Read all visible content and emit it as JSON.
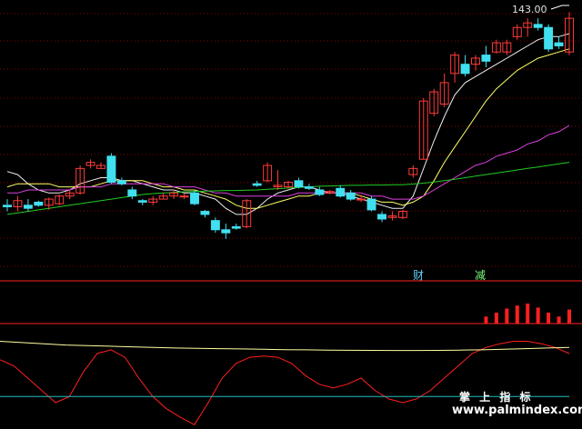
{
  "header": {
    "last_price": "143.00"
  },
  "signals": {
    "left": "财",
    "right": "减"
  },
  "watermark": {
    "name": "掌 上 指 标",
    "url": "www.palmindex.com"
  },
  "colors": {
    "background": "#000000",
    "grid": "#8b0000",
    "up_candle": "#ff3b3b",
    "down_candle": "#40e0f0",
    "ma_white": "#f0f0f0",
    "ma_yellow": "#ffff66",
    "ma_magenta": "#e040e0",
    "ma_green": "#22cc22",
    "osc_red": "#ff2020",
    "osc_yellow": "#ffffa0",
    "osc_cyan": "#20c0c0",
    "separator": "#ff2020"
  },
  "chart_data": [
    {
      "type": "candlestick",
      "title": "",
      "ylim": [
        60,
        146
      ],
      "candles": [
        [
          82,
          84,
          80,
          81.5
        ],
        [
          81.5,
          85,
          80,
          83.5
        ],
        [
          82,
          84,
          80,
          81
        ],
        [
          83,
          83.5,
          81.5,
          82
        ],
        [
          82,
          84.5,
          80.5,
          84
        ],
        [
          82.5,
          85.5,
          82,
          85
        ],
        [
          85,
          87,
          84,
          86
        ],
        [
          86,
          95,
          85.5,
          94
        ],
        [
          95,
          97,
          94,
          96
        ],
        [
          94,
          96,
          94,
          95
        ],
        [
          98,
          99,
          89,
          89.5
        ],
        [
          90,
          91,
          88.5,
          89
        ],
        [
          87,
          88,
          84,
          85
        ],
        [
          83.5,
          84,
          82,
          83
        ],
        [
          83,
          85,
          82,
          84
        ],
        [
          84,
          86,
          84,
          85
        ],
        [
          85,
          87,
          84,
          86
        ],
        [
          85,
          86,
          84,
          85
        ],
        [
          86,
          87,
          82,
          82.5
        ],
        [
          80,
          80.5,
          78,
          79
        ],
        [
          77,
          78,
          73,
          74
        ],
        [
          74,
          76,
          71,
          73
        ],
        [
          75,
          76,
          74,
          74.5
        ],
        [
          75,
          84,
          74.5,
          83.5
        ],
        [
          89,
          90,
          88,
          88.5
        ],
        [
          90,
          96,
          89.5,
          95
        ],
        [
          88,
          93.5,
          87,
          88.5
        ],
        [
          88,
          90,
          87.5,
          89.5
        ],
        [
          90,
          91,
          87.5,
          88
        ],
        [
          88,
          89,
          87,
          87.5
        ],
        [
          87,
          88,
          85,
          85.5
        ],
        [
          86,
          87,
          85.5,
          86.5
        ],
        [
          87.5,
          88.5,
          84.5,
          85
        ],
        [
          86,
          87,
          83.5,
          84
        ],
        [
          84,
          85.5,
          83,
          84
        ],
        [
          84,
          85,
          80,
          80.5
        ],
        [
          79,
          80,
          76.5,
          77.5
        ],
        [
          78,
          80,
          77,
          78.5
        ],
        [
          78,
          80.5,
          77.5,
          80
        ],
        [
          92,
          95,
          91,
          94
        ],
        [
          97,
          117,
          97,
          116
        ],
        [
          112,
          120,
          111,
          119
        ],
        [
          115,
          125,
          114,
          122
        ],
        [
          125,
          132,
          122,
          131
        ],
        [
          128,
          131,
          124,
          125
        ],
        [
          128,
          131,
          126,
          130
        ],
        [
          131,
          134,
          127,
          129
        ],
        [
          132,
          136,
          131.5,
          135
        ],
        [
          132,
          136,
          131,
          135
        ],
        [
          137,
          141,
          136,
          140
        ],
        [
          140,
          143,
          137,
          141.5
        ],
        [
          141,
          143,
          139,
          140
        ],
        [
          140,
          141,
          132,
          133
        ],
        [
          135,
          137,
          133,
          134
        ],
        [
          132,
          145,
          131,
          143
        ]
      ],
      "series": [
        {
          "color": "#f0f0f0",
          "values": [
            93,
            92,
            89,
            87,
            86,
            86,
            87,
            89,
            90,
            91,
            91,
            90,
            90,
            89,
            88,
            87,
            87,
            86,
            86,
            85,
            84,
            81,
            79,
            79,
            81,
            84,
            86,
            87,
            88,
            88,
            87,
            86,
            86,
            85,
            84,
            83,
            82,
            81,
            81,
            85,
            94,
            103,
            111,
            118,
            122,
            124,
            126,
            128,
            130,
            132,
            134,
            136,
            137,
            137,
            138
          ]
        },
        {
          "color": "#ffff66",
          "values": [
            88,
            89,
            89,
            89,
            89,
            88,
            88,
            88,
            88,
            89,
            90,
            90,
            90,
            90,
            89,
            88,
            88,
            87,
            87,
            86,
            85,
            84,
            82,
            81,
            81,
            82,
            83,
            84,
            85,
            85,
            86,
            86,
            86,
            86,
            85,
            84,
            83,
            83,
            82,
            83,
            85,
            90,
            96,
            101,
            106,
            111,
            116,
            120,
            123,
            126,
            128,
            130,
            131,
            132,
            133
          ]
        },
        {
          "color": "#e040e0",
          "values": [
            86,
            86,
            87,
            87,
            87,
            87,
            87,
            88,
            88,
            88,
            89,
            89,
            89,
            89,
            89,
            89,
            88,
            88,
            88,
            87,
            86,
            86,
            85,
            85,
            85,
            85,
            85,
            85,
            86,
            86,
            86,
            86,
            86,
            86,
            86,
            85,
            85,
            84,
            84,
            84,
            85,
            87,
            89,
            91,
            93,
            95,
            96,
            98,
            99,
            100,
            102,
            103,
            105,
            106,
            108
          ]
        },
        {
          "color": "#22cc22",
          "values": [
            79,
            79.5,
            80,
            80.5,
            81,
            81.5,
            82,
            82.5,
            83,
            83.5,
            84,
            84.5,
            85,
            85.5,
            85.8,
            86,
            86.2,
            86.4,
            86.5,
            86.6,
            86.7,
            86.8,
            86.8,
            86.9,
            87,
            87.2,
            87.4,
            87.6,
            87.8,
            88,
            88.2,
            88.3,
            88.4,
            88.5,
            88.5,
            88.6,
            88.6,
            88.7,
            88.7,
            88.9,
            89.2,
            89.6,
            90,
            90.5,
            91,
            91.5,
            92,
            92.5,
            93,
            93.5,
            94,
            94.5,
            95,
            95.5,
            96
          ]
        }
      ]
    },
    {
      "type": "bar",
      "title": "",
      "ylim": [
        0,
        1
      ],
      "values": [
        0,
        0,
        0,
        0,
        0,
        0,
        0,
        0,
        0,
        0,
        0,
        0,
        0,
        0,
        0,
        0,
        0,
        0,
        0,
        0,
        0,
        0,
        0,
        0,
        0,
        0,
        0,
        0,
        0,
        0,
        0,
        0,
        0,
        0,
        0,
        0,
        0,
        0,
        0,
        0,
        0,
        0,
        0,
        0,
        0,
        0,
        0.35,
        0.55,
        0.75,
        0.9,
        1,
        0.8,
        0.55,
        0.35,
        0.7
      ]
    },
    {
      "type": "line",
      "title": "",
      "ylim": [
        -60,
        20
      ],
      "series": [
        {
          "color": "#ff2020",
          "values": [
            -5,
            -10,
            -20,
            -30,
            -40,
            -35,
            -15,
            0,
            3,
            -3,
            -20,
            -35,
            -45,
            -52,
            -58,
            -40,
            -20,
            -8,
            -3,
            -2,
            -3,
            -8,
            -18,
            -25,
            -28,
            -25,
            -20,
            -30,
            -37,
            -40,
            -37,
            -30,
            -20,
            -10,
            0,
            5,
            8,
            10,
            10,
            8,
            5,
            0
          ]
        },
        {
          "color": "#ffffa0",
          "values": [
            10,
            9,
            8,
            7,
            6.5,
            6,
            5.5,
            5,
            4.5,
            4.2,
            4,
            3.8,
            3.5,
            3.2,
            3,
            2.8,
            2.7,
            2.6,
            2.5,
            2.5,
            2.6,
            2.8,
            3,
            3.5,
            4,
            4.5,
            5
          ]
        },
        {
          "color": "#20c0c0",
          "values": [
            -35,
            -35
          ]
        }
      ]
    }
  ]
}
